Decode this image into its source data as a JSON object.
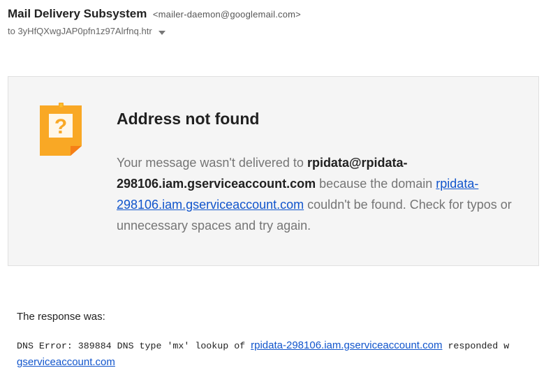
{
  "header": {
    "sender_name": "Mail Delivery Subsystem",
    "sender_email": "<mailer-daemon@googlemail.com>",
    "to_line": "to 3yHfQXwgJAP0pfn1z97Alrfnq.htr"
  },
  "card": {
    "icon": "question-note-icon",
    "title": "Address not found",
    "body_text_1": "Your message wasn't delivered to ",
    "recipient": "rpidata@rpidata-298106.iam.gserviceaccount.com",
    "body_text_2": " because the domain ",
    "domain_link": "rpidata-298106.iam.gserviceaccount.com",
    "body_text_3": " couldn't be found. Check for typos or unnecessary spaces and try again."
  },
  "response": {
    "label": "The response was:",
    "dns_prefix": "DNS Error: 389884 DNS type 'mx' lookup of ",
    "dns_link": "rpidata-298106.iam.gserviceaccount.com",
    "dns_suffix": " responded w",
    "dns_link_continued": "gserviceaccount.com"
  },
  "colors": {
    "accent_orange": "#f9a825",
    "link_blue": "#1155cc",
    "card_bg": "#f5f5f5"
  }
}
